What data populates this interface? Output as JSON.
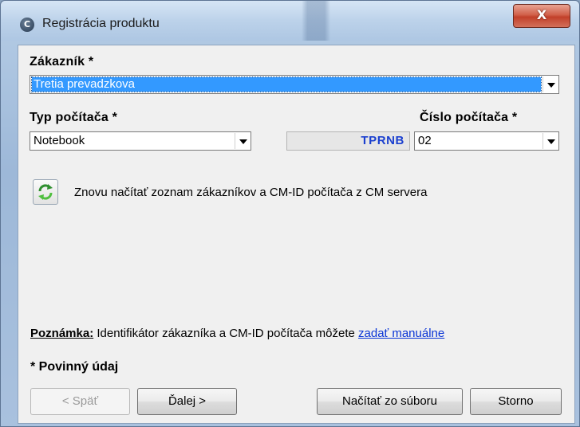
{
  "window": {
    "title": "Registrácia produktu",
    "close_label": "X"
  },
  "form": {
    "customer_label": "Zákazník *",
    "customer_value": "Tretia prevadzkova",
    "computer_type_label": "Typ počítača *",
    "computer_type_value": "Notebook",
    "computer_id_prefix": "TPRNB",
    "computer_number_label": "Číslo počítača *",
    "computer_number_value": "02",
    "refresh_text": "Znovu načítať zoznam zákazníkov a CM-ID počítača z CM servera"
  },
  "note": {
    "label": "Poznámka:",
    "text": " Identifikátor zákazníka a CM-ID počítača môžete ",
    "link": "zadať manuálne"
  },
  "required_text": "* Povinný údaj",
  "buttons": {
    "back": "< Späť",
    "next": "Ďalej >",
    "load_file": "Načítať zo súboru",
    "cancel": "Storno"
  },
  "colors": {
    "selection": "#3399ff",
    "id_text": "#1a3fcf",
    "link": "#0a35d6"
  },
  "icons": {
    "app": "app-icon",
    "refresh": "refresh-icon"
  }
}
